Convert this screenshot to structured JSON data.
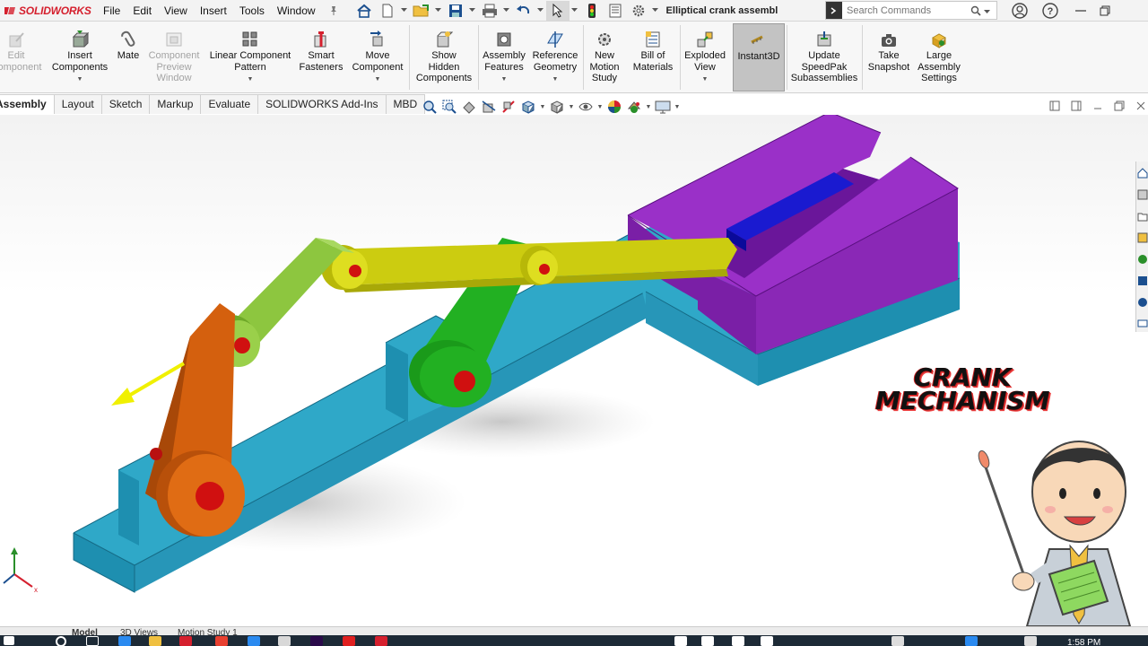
{
  "app": {
    "brand": "SOLIDWORKS",
    "document_title": "Elliptical crank assembl...",
    "accent_color": "#d5202e"
  },
  "menu": {
    "items": [
      "File",
      "Edit",
      "View",
      "Insert",
      "Tools",
      "Window"
    ]
  },
  "search": {
    "placeholder": "Search Commands"
  },
  "ribbon": {
    "edit_component": "Edit\nComponent",
    "insert_components": "Insert\nComponents",
    "mate": "Mate",
    "component_preview": "Component\nPreview\nWindow",
    "linear_pattern": "Linear Component\nPattern",
    "smart_fasteners": "Smart\nFasteners",
    "move_component": "Move\nComponent",
    "show_hidden": "Show\nHidden\nComponents",
    "assembly_features": "Assembly\nFeatures",
    "reference_geometry": "Reference\nGeometry",
    "new_motion_study": "New\nMotion\nStudy",
    "bill_of_materials": "Bill of\nMaterials",
    "exploded_view": "Exploded\nView",
    "instant3d": "Instant3D",
    "update_speedpak": "Update\nSpeedPak\nSubassemblies",
    "take_snapshot": "Take\nSnapshot",
    "large_assembly": "Large\nAssembly\nSettings"
  },
  "tabs": [
    "Assembly",
    "Layout",
    "Sketch",
    "Markup",
    "Evaluate",
    "SOLIDWORKS Add-Ins",
    "MBD"
  ],
  "overlay": {
    "line1": "CRANK",
    "line2": "MECHANISM"
  },
  "model_tabs": [
    "Model",
    "3D Views",
    "Motion Study 1"
  ],
  "taskbar": {
    "time": "1:58 PM"
  },
  "colors": {
    "base": "#2fa8c8",
    "slider_block": "#9a30c8",
    "slider_insert": "#1a1ad0",
    "crank_orange": "#d4600e",
    "link_green": "#8dc63f",
    "rocker_green": "#22b022",
    "coupler_yellow": "#cccc10",
    "pin_red": "#d01010",
    "arrow_yellow": "#f0f000"
  }
}
